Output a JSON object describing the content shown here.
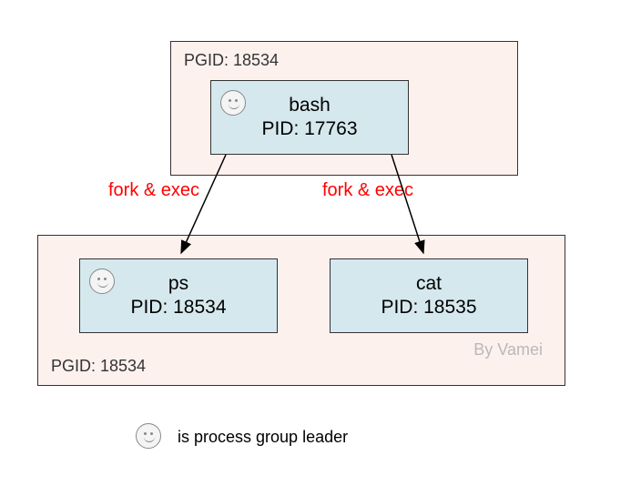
{
  "top_group": {
    "pgid_label": "PGID: 18534"
  },
  "bottom_group": {
    "pgid_label": "PGID: 18534"
  },
  "processes": {
    "bash": {
      "name": "bash",
      "pid_line": "PID: 17763"
    },
    "ps": {
      "name": "ps",
      "pid_line": "PID: 18534"
    },
    "cat": {
      "name": "cat",
      "pid_line": "PID: 18535"
    }
  },
  "edges": {
    "left": "fork & exec",
    "right": "fork & exec"
  },
  "legend": {
    "text": "is process group leader"
  },
  "watermark": "By Vamei"
}
